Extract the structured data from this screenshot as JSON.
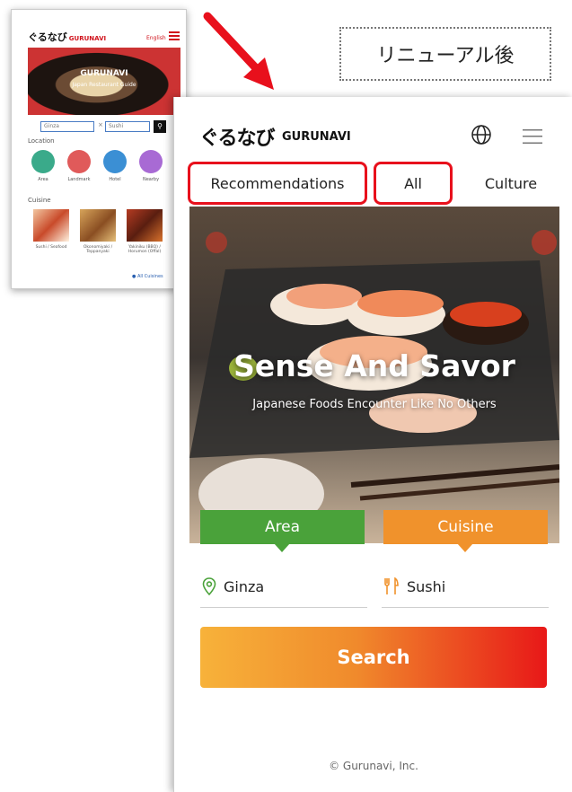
{
  "before_thumbnail": {
    "logo_jp": "ぐるなび",
    "logo_en": "GURUNAVI",
    "language": "English",
    "hero_title": "GURUNAVI",
    "hero_subtitle": "Japan Restaurant Guide",
    "area_value": "Ginza",
    "separator": "×",
    "cuisine_value": "Sushi",
    "location_heading": "Location",
    "location_items": [
      "Area",
      "Landmark",
      "Hotel",
      "Nearby"
    ],
    "cuisine_heading": "Cuisine",
    "cuisine_items": [
      "Sushi / Seafood",
      "Okonomiyaki / Teppanyaki",
      "Yakiniku (BBQ) / Horumon (Offal)"
    ],
    "all_cuisines_link": "All Cuisines"
  },
  "after_label": "リニューアル後",
  "after": {
    "logo_jp": "ぐるなび",
    "logo_en": "GURUNAVI",
    "tabs": [
      {
        "label": "Recommendations",
        "highlighted": true
      },
      {
        "label": "All",
        "highlighted": true
      },
      {
        "label": "Culture",
        "highlighted": false
      }
    ],
    "hero_title": "Sense And Savor",
    "hero_subtitle": "Japanese Foods Encounter Like No Others",
    "search_tabs": {
      "area": "Area",
      "cuisine": "Cuisine"
    },
    "area_value": "Ginza",
    "cuisine_value": "Sushi",
    "search_button": "Search",
    "copyright": "© Gurunavi, Inc."
  },
  "colors": {
    "highlight_red": "#e8101c",
    "area_green": "#4aa23a",
    "cuisine_orange": "#f0922c",
    "brand_red": "#d0121b"
  },
  "icons": [
    "globe-icon",
    "hamburger-menu-icon",
    "location-pin-icon",
    "fork-knife-icon",
    "search-icon",
    "red-arrow"
  ]
}
